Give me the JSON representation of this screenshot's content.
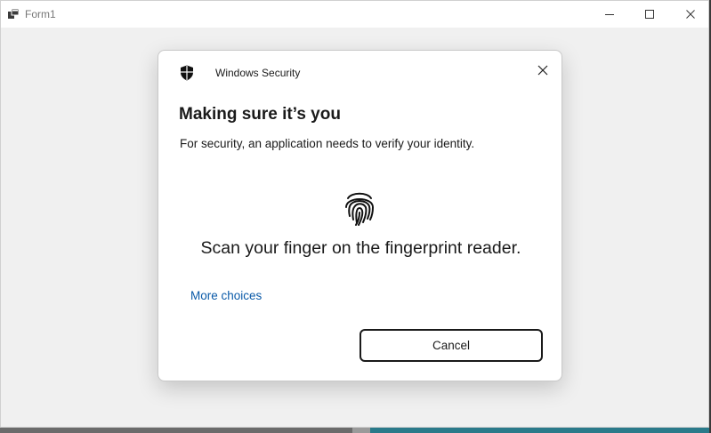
{
  "window": {
    "title": "Form1",
    "icons": {
      "app": "form-app-icon",
      "minimize": "minimize-icon",
      "maximize": "maximize-icon",
      "close": "close-icon"
    }
  },
  "dialog": {
    "app_title": "Windows Security",
    "heading": "Making sure it’s you",
    "body": "For security, an application needs to verify your identity.",
    "prompt": "Scan your finger on the fingerprint reader.",
    "more_choices": "More choices",
    "cancel": "Cancel",
    "icons": {
      "brand": "shield-icon",
      "close": "close-icon",
      "prompt": "fingerprint-icon"
    },
    "colors": {
      "link": "#0a5aa8",
      "text": "#1a1a1a"
    }
  }
}
